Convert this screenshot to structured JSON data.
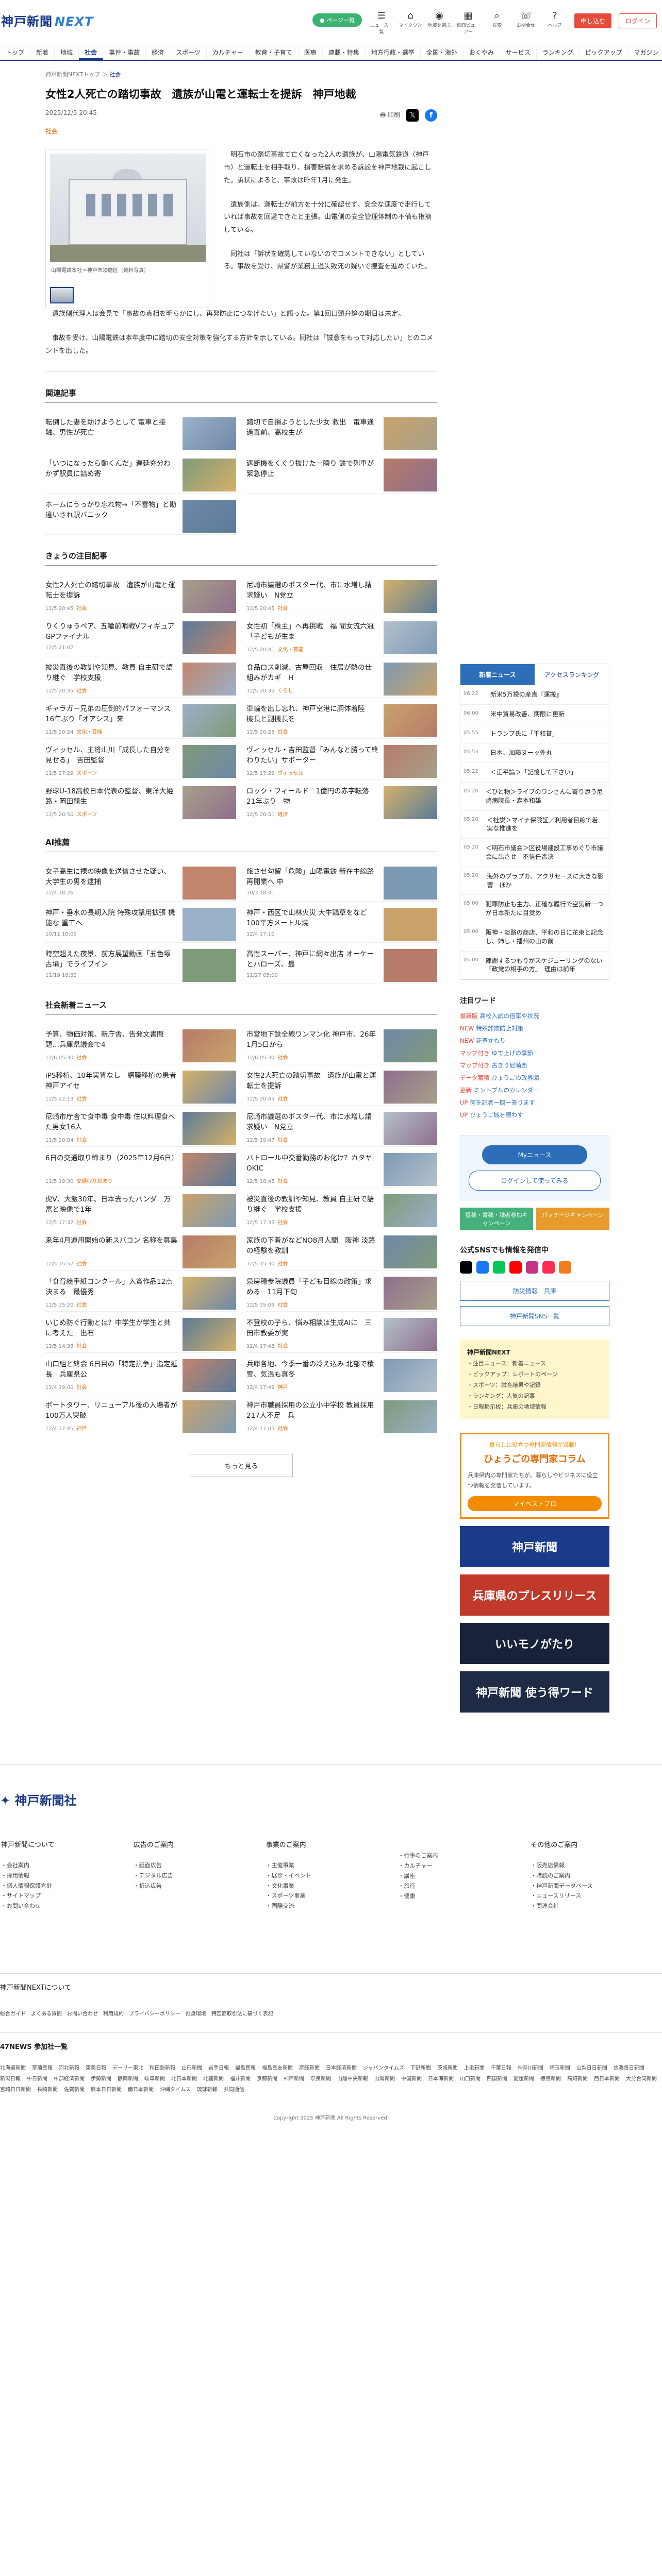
{
  "header": {
    "logo_main": "神戸新聞",
    "logo_sub": "NEXT",
    "pill": "● ページ一覧",
    "tools": [
      {
        "icon": "☰",
        "label": "ニュース一覧"
      },
      {
        "icon": "⌂",
        "label": "マイタウン"
      },
      {
        "icon": "◉",
        "label": "地域を選ぶ"
      },
      {
        "icon": "▦",
        "label": "紙面ビューアー"
      },
      {
        "icon": "⌕",
        "label": "検索"
      },
      {
        "icon": "☏",
        "label": "お問合せ"
      },
      {
        "icon": "?",
        "label": "ヘルプ"
      }
    ],
    "subscribe": "申し込む",
    "login": "ログイン"
  },
  "nav": [
    "トップ",
    "新着",
    "地域",
    "社会",
    "事件・事故",
    "経済",
    "スポーツ",
    "カルチャー",
    "教育・子育て",
    "医療",
    "連載・特集",
    "地方行政・選挙",
    "全国・海外",
    "おくやみ",
    "サービス",
    "ランキング",
    "ピックアップ",
    "マガジン"
  ],
  "nav_active": "社会",
  "article": {
    "breadcrumb_home": "神戸新聞NEXTトップ",
    "breadcrumb_cat": "社会",
    "title": "女性2人死亡の踏切事故　遺族が山電と運転士を提訴　神戸地裁",
    "date": "2025/12/5 20:45",
    "print_label": "印刷",
    "category": "社会",
    "caption": "山陽電鉄本社＝神戸市須磨区（資料写真）",
    "paragraphs": [
      "明石市の踏切事故で亡くなった2人の遺族が、山陽電気鉄道（神戸市）と運転士を相手取り、損害賠償を求める訴訟を神戸地裁に起こした。訴状によると、事故は昨年1月に発生。",
      "遺族側は、運転士が前方を十分に確認せず、安全な速度で走行していれば事故を回避できたと主張。山電側の安全管理体制の不備も指摘している。",
      "同社は「訴状を確認していないのでコメントできない」としている。事故を受け、県警が業務上過失致死の疑いで捜査を進めていた。",
      "遺族側代理人は会見で「事故の真相を明らかにし、再発防止につなげたい」と語った。第1回口頭弁論の期日は未定。",
      "事故を受け、山陽電鉄は本年度中に踏切の安全対策を強化する方針を示している。同社は「誠意をもって対応したい」とのコメントを出した。"
    ]
  },
  "sections": [
    {
      "title": "関連記事",
      "cards": [
        {
          "headline": "転倒した妻を助けようとして 電車と接触、男性が死亡",
          "date": "",
          "tag": ""
        },
        {
          "headline": "踏切で自損ようとした少女 救出　電車通過直前、高校生が",
          "date": "",
          "tag": ""
        },
        {
          "headline": "「いつになったら動くんだ」遅延充分わかず駅員に詰め寄",
          "date": "",
          "tag": ""
        },
        {
          "headline": "遮断機をくぐり抜けた一瞬り 鉄で列車が緊急停止",
          "date": "",
          "tag": ""
        },
        {
          "headline": "ホームにうっかり忘れ物→「不審物」と勘違いされ駅パニック",
          "date": "",
          "tag": ""
        }
      ]
    },
    {
      "title": "きょうの注目記事",
      "cards": [
        {
          "headline": "女性2人死亡の踏切事故　遺族が山電と運転士を提訴",
          "date": "12/5 20:45",
          "tag": "社会"
        },
        {
          "headline": "尼崎市議選のポスター代、市に水増し請求疑い　N党立",
          "date": "12/5 20:45",
          "tag": "社会"
        },
        {
          "headline": "",
          "date": "",
          "tag": ""
        },
        {
          "headline": "りくりゅうペア、五輪前哨戦Vフィギュア GPファイナル",
          "date": "12/5 21:07",
          "tag": ""
        },
        {
          "headline": "女性初「株主」へ再挑戦　福 聞女流六冠「子どもが生ま",
          "date": "12/5 20:41",
          "tag": "文化・芸能"
        },
        {
          "headline": "被災直後の教訓や知見、教員 自主研で語り継ぐ　学校支援",
          "date": "12/5 20:35",
          "tag": "社会"
        },
        {
          "headline": "食品ロス削減、古屋回収　住居が熱の仕組みがカギ　H",
          "date": "12/5 20:35",
          "tag": "くらし"
        },
        {
          "headline": "ギャラガー兄弟の圧倒的パフォーマンス 16年ぶり「オアシス」来",
          "date": "12/5 20:24",
          "tag": "文化・芸能"
        },
        {
          "headline": "車輪を出し忘れ、神戸空港に胴体着陸　機長と副機長を",
          "date": "12/5 20:25",
          "tag": "社会"
        },
        {
          "headline": "ヴィッセル、主将山川「成長した自分を見せる」　吉田監督",
          "date": "12/5 17:29",
          "tag": "スポーツ"
        },
        {
          "headline": "ヴィッセル・吉田監督「みんなと勝って終わりたい」サポーター",
          "date": "12/5 17:29",
          "tag": "ヴィッセル"
        },
        {
          "headline": "",
          "date": "",
          "tag": ""
        },
        {
          "headline": "野球U-18高校日本代表の監督、東洋大姫路・岡田龍生",
          "date": "12/5 20:50",
          "tag": "スポーツ"
        },
        {
          "headline": "ロック・フィールド　1億円の赤字転落　21年ぶり　物",
          "date": "12/5 20:51",
          "tag": "経済"
        }
      ]
    },
    {
      "title": "AI推薦",
      "cards": [
        {
          "headline": "女子高生に裸の映像を送信させた疑い、大学生の男を逮捕",
          "date": "12/4 18:26",
          "tag": ""
        },
        {
          "headline": "旅させ勾留「危険」山陽電鉄 新在中線路再開業へ 中",
          "date": "10/3 18:41",
          "tag": ""
        },
        {
          "headline": "神戸・垂水の長期入院 特殊攻撃用拡張 機能な 重工へ",
          "date": "10/11 10:00",
          "tag": ""
        },
        {
          "headline": "神戸・西区で山林火災 大牛鶏草をなど100平方メートル焼",
          "date": "12/4 17:10",
          "tag": ""
        },
        {
          "headline": "時空超えた夜景、前方展望動画「五色塚古墳」でライブイン",
          "date": "11/19 16:32",
          "tag": ""
        },
        {
          "headline": "高性スーパー、神戸に網々出店 オーケーとハローズ、最",
          "date": "11/27 05:00",
          "tag": ""
        }
      ]
    },
    {
      "title": "社会新着ニュース",
      "cards": [
        {
          "headline": "予算、物価対策、新庁舎、告発文書問題…兵庫県議会で4",
          "date": "12/6 05:30",
          "tag": "社会"
        },
        {
          "headline": "市営地下鉄全線ワンマン化 神戸市、26年1月5日から",
          "date": "12/6 05:30",
          "tag": "社会"
        },
        {
          "headline": "",
          "date": "",
          "tag": ""
        },
        {
          "headline": "iPS移植、10年実質なし　網膜移植の患者　神戸アイセ",
          "date": "12/5 22:13",
          "tag": "社会"
        },
        {
          "headline": "女性2人死亡の踏切事故　遺族が山電と運転士を提訴",
          "date": "12/5 20:45",
          "tag": "社会"
        },
        {
          "headline": "尼崎市庁舎で食中毒 食中毒 住以料理食べた男女16人",
          "date": "12/5 20:04",
          "tag": "社会"
        },
        {
          "headline": "尼崎市議選のポスター代、市に水増し請求疑い　N党立",
          "date": "12/5 19:47",
          "tag": "社会"
        },
        {
          "headline": "6日の交通取り締まり（2025年12月6日）",
          "date": "12/5 19:30",
          "tag": "交通取り締まり"
        },
        {
          "headline": "パトロール中交番勤務のお化け？カタヤOKIC",
          "date": "12/5 18:45",
          "tag": "社会"
        },
        {
          "headline": "",
          "date": "",
          "tag": ""
        },
        {
          "headline": "虎V、大飯30年、日本去ったパンダ　万富と映像で1年",
          "date": "12/5 17:37",
          "tag": "社会"
        },
        {
          "headline": "被災直後の教訓や知見、教員 自主研で語り継ぐ　学校支援",
          "date": "12/5 17:35",
          "tag": "社会"
        },
        {
          "headline": "来年4月運用開始の新スバコン 名称を募集",
          "date": "12/5 15:57",
          "tag": "社会"
        },
        {
          "headline": "家族の下着がなどNO8月人間　阪神 淡路の経験を教訓",
          "date": "12/5 15:30",
          "tag": "社会"
        },
        {
          "headline": "",
          "date": "",
          "tag": ""
        },
        {
          "headline": "「食育絵手紙コンクール」入賞作品12点決まる　最優秀",
          "date": "12/5 15:20",
          "tag": "社会"
        },
        {
          "headline": "泉房穂参院議員「子ども目線の政策」求める　11月下旬",
          "date": "12/5 15:09",
          "tag": "社会"
        },
        {
          "headline": "いじめ防ぐ行動とは？中学生が学生と共に考えた　出石",
          "date": "12/5 14:38",
          "tag": "社会"
        },
        {
          "headline": "不登校の子ら、悩み相談は生成AIに　三田市教委が実",
          "date": "12/4 17:48",
          "tag": "社会"
        },
        {
          "headline": "山口組と終会 6日目の「特定抗争」指定延長　兵庫県公",
          "date": "12/4 19:00",
          "tag": "社会"
        },
        {
          "headline": "兵庫各地、今季一番の冷え込み 北部で積雪、気温も真冬",
          "date": "12/4 17:49",
          "tag": "神戸"
        },
        {
          "headline": "",
          "date": "",
          "tag": ""
        },
        {
          "headline": "ポートタワー、リニューアル後の入場者が100万人突破",
          "date": "12/4 17:45",
          "tag": "神戸"
        },
        {
          "headline": "神戸市職員採用の公立小中学校 教員採用217人不足　兵",
          "date": "12/4 17:05",
          "tag": "社会"
        }
      ]
    }
  ],
  "more_label": "もっと見る",
  "sidebar": {
    "tab_news": "新着ニュース",
    "tab_rank": "アクセスランキング",
    "ranks": [
      {
        "time": "06:22",
        "text": "新米5万袋の産直『運搬』"
      },
      {
        "time": "06:00",
        "text": "米中貿易改善、期限に更新"
      },
      {
        "time": "05:55",
        "text": "トランプ氏に「平和賞」"
      },
      {
        "time": "05:53",
        "text": "日本、加藤ヌーッ外丸"
      },
      {
        "time": "05:22",
        "text": "＜正平論＞「記憶して下さい」"
      },
      {
        "time": "05:20",
        "text": "＜ひと物＞ライブのワンさんに寄り添う尼崎病院長・森本和雄"
      },
      {
        "time": "05:20",
        "text": "＜社説＞マイナ保険証／利用者目線で着実な推進を"
      },
      {
        "time": "05:20",
        "text": "＜明石市議会＞区役場建設工事めぐり市議会に出させ　不信任否決"
      },
      {
        "time": "05:20",
        "text": "海外のプラプカ、アクサセーズに大きな影響　ほか"
      },
      {
        "time": "05:00",
        "text": "犯罪防止も主力、正確な履行で空気新一つが日本新たに目覚め"
      },
      {
        "time": "05:00",
        "text": "阪神・淡路の商店、平和の日に花束と記念し、姉し・播州の山の前"
      },
      {
        "time": "05:00",
        "text": "陳謝するつもりがスケジューリングのない　「政党の相手の方」　理由は前年"
      }
    ],
    "tag_title": "注目ワード",
    "tags": [
      {
        "badge": "最新版",
        "text": "高校入試の倍率や状況"
      },
      {
        "badge": "NEW",
        "text": "特殊詐欺防止対策"
      },
      {
        "badge": "NEW",
        "text": "花豊かもり"
      },
      {
        "badge": "マップ付き",
        "text": "ゆで上げの季節"
      },
      {
        "badge": "マップ付き",
        "text": "古きり尼崎西"
      },
      {
        "badge": "データ蓄積",
        "text": "ひょうごの政界図"
      },
      {
        "badge": "更新",
        "text": "ミントブルのカレンダー"
      },
      {
        "badge": "UP",
        "text": "何を記者一問一答ります"
      },
      {
        "badge": "UP",
        "text": "ひょうご城を賑わす"
      }
    ],
    "my_title": "Myニュース",
    "my_login": "ログインして使ってみる",
    "green_left": "投稿・寄稿・読者参加キャンペーン",
    "green_right": "パッケージキャンペーン",
    "sns_title": "公式SNSでも情報を発信中",
    "sns_btn1": "防災情報　兵庫",
    "sns_btn2": "神戸新聞SNS一覧",
    "yellow_title": "神戸新聞NEXT",
    "yellow_lines": [
      "・注目ニュース：新着ニュース",
      "・ピックアップ：レポートのページ",
      "・スポーツ：試合結果や記録",
      "・ランキング：人気の記事",
      "・日報掲示板：兵庫の地域情報"
    ],
    "orange_kicker": "暮らしに役立つ専門家情報が満載！",
    "orange_title": "ひょうごの専門家コラム",
    "orange_body": "兵庫県内の専門家たちが、暮らしやビジネスに役立つ情報を発信しています。",
    "orange_btn": "マイベストプロ",
    "banners": [
      {
        "text": "神戸新聞",
        "color": "#1a3a8a"
      },
      {
        "text": "兵庫県のプレスリリース",
        "color": "#c0392b"
      },
      {
        "text": "いいモノがたり",
        "color": "#18233a"
      },
      {
        "text": "神戸新聞 使う得ワード",
        "color": "#1f2a44"
      }
    ]
  },
  "footer": {
    "logo": "神戸新聞社",
    "cols": [
      {
        "title": "神戸新聞について",
        "items": [
          "会社案内",
          "採用情報",
          "個人情報保護方針",
          "サイトマップ",
          "お問い合わせ"
        ]
      },
      {
        "title": "広告のご案内",
        "items": [
          "紙面広告",
          "デジタル広告",
          "折込広告"
        ]
      },
      {
        "title": "事業のご案内",
        "items": [
          "主催事業",
          "展示・イベント",
          "文化事業",
          "スポーツ事業",
          "国際交流"
        ]
      },
      {
        "title": "",
        "items": [
          "行事のご案内",
          "カルチャー",
          "講座",
          "旅行",
          "健康"
        ]
      },
      {
        "title": "その他のご案内",
        "items": [
          "販売店情報",
          "購読のご案内",
          "神戸新聞データベース",
          "ニュースリリース",
          "関連会社"
        ]
      }
    ],
    "next_about": "神戸新聞NEXTについて",
    "mini": [
      "総合ガイド",
      "よくある質問",
      "お問い合わせ",
      "利用規約",
      "プライバシーポリシー",
      "推奨環境",
      "特定商取引法に基づく表記"
    ],
    "f47": "47NEWS 参加社一覧",
    "prefs": [
      "北海道新聞",
      "室蘭民報",
      "河北新報",
      "東奥日報",
      "デーリー東北",
      "秋田魁新報",
      "山形新聞",
      "岩手日報",
      "福島民報",
      "福島民友新聞",
      "産経新聞",
      "日本経済新聞",
      "ジャパンタイムズ",
      "下野新聞",
      "茨城新聞",
      "上毛新聞",
      "千葉日報",
      "神奈川新聞",
      "埼玉新聞",
      "山梨日日新聞",
      "信濃毎日新聞",
      "新潟日報",
      "中日新聞",
      "中部経済新聞",
      "伊勢新聞",
      "静岡新聞",
      "岐阜新聞",
      "北日本新聞",
      "北國新聞",
      "福井新聞",
      "京都新聞",
      "神戸新聞",
      "奈良新聞",
      "山陰中央新報",
      "山陽新聞",
      "中国新聞",
      "日本海新聞",
      "山口新聞",
      "四国新聞",
      "愛媛新聞",
      "徳島新聞",
      "高知新聞",
      "西日本新聞",
      "大分合同新聞",
      "宮崎日日新聞",
      "長崎新聞",
      "佐賀新聞",
      "熊本日日新聞",
      "南日本新聞",
      "沖縄タイムス",
      "琉球新報",
      "共同通信"
    ],
    "copyright": "Copyright 2025 神戸新聞 All Rights Reserved."
  }
}
